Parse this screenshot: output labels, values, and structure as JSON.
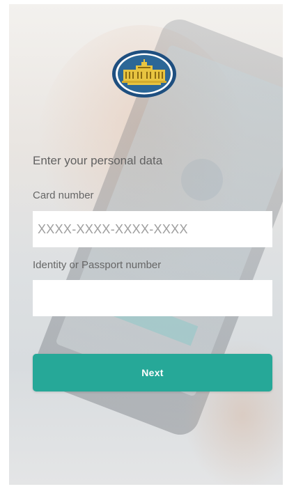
{
  "form": {
    "heading": "Enter your personal data",
    "card_label": "Card number",
    "card_placeholder": "XXXX-XXXX-XXXX-XXXX",
    "card_value": "",
    "id_label": "Identity or Passport number",
    "id_placeholder": "",
    "id_value": "",
    "next_label": "Next"
  },
  "icons": {
    "logo": "national-bank-building-logo"
  },
  "colors": {
    "accent": "#26a898",
    "logo_ring": "#1e4f80",
    "logo_gold": "#e8c440"
  }
}
